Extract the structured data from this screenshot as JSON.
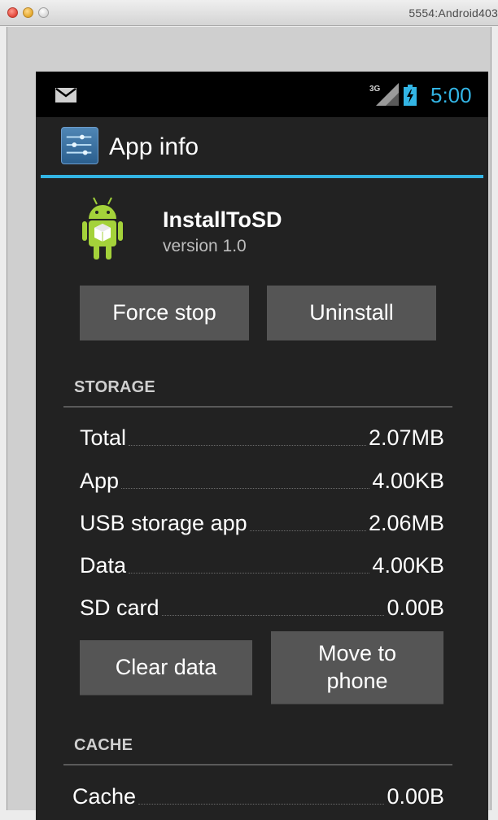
{
  "window": {
    "title": "5554:Android403"
  },
  "status_bar": {
    "network_label": "3G",
    "time": "5:00",
    "accent_color": "#33b5e5",
    "icons": [
      "mail-icon",
      "signal-3g-icon",
      "battery-charging-icon"
    ]
  },
  "action_bar": {
    "title": "App info",
    "icon": "settings-sliders-icon"
  },
  "app": {
    "name": "InstallToSD",
    "version": "version 1.0",
    "icon": "android-app-icon"
  },
  "buttons": {
    "force_stop": "Force stop",
    "uninstall": "Uninstall",
    "clear_data": "Clear data",
    "move_to_phone": "Move to\nphone"
  },
  "storage": {
    "header": "STORAGE",
    "rows": [
      {
        "label": "Total",
        "value": "2.07MB"
      },
      {
        "label": "App",
        "value": "4.00KB"
      },
      {
        "label": "USB storage app",
        "value": "2.06MB"
      },
      {
        "label": "Data",
        "value": "4.00KB"
      },
      {
        "label": "SD card",
        "value": "0.00B"
      }
    ]
  },
  "cache": {
    "header": "CACHE",
    "rows": [
      {
        "label": "Cache",
        "value": "0.00B"
      }
    ]
  }
}
